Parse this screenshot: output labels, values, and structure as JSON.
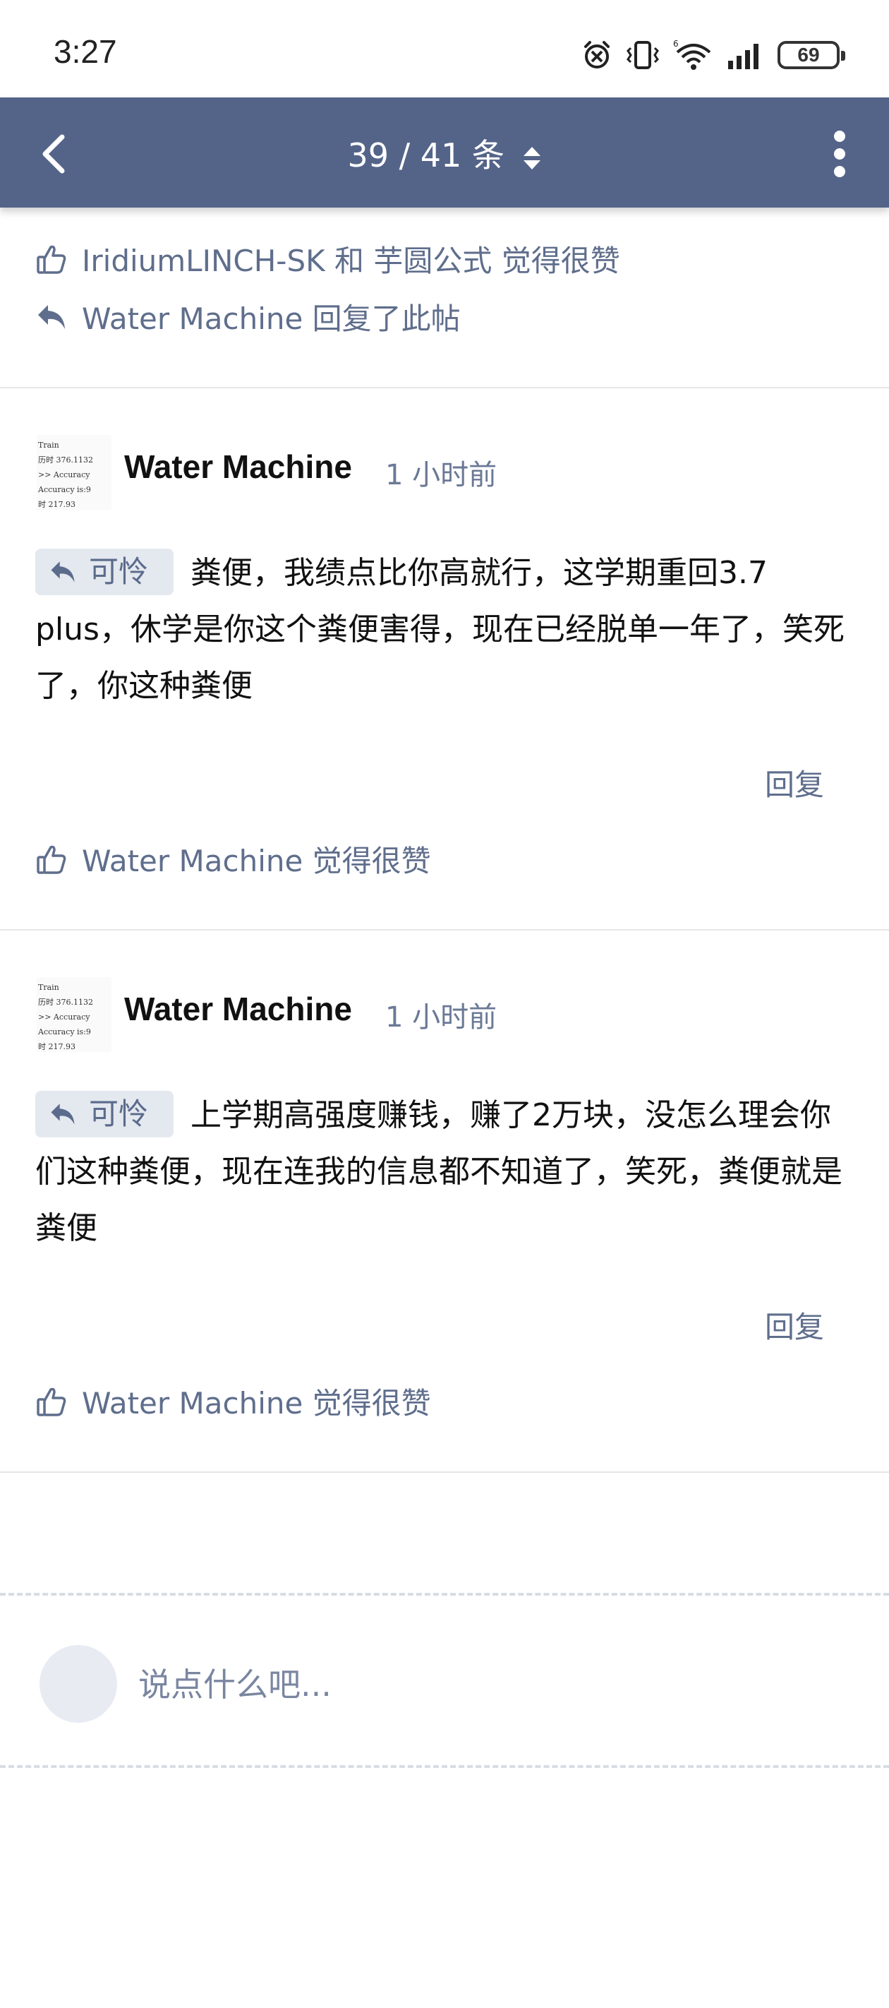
{
  "status_bar": {
    "time": "3:27",
    "battery": "69"
  },
  "header": {
    "counter": "39 / 41 条"
  },
  "activity_top": {
    "likes": "IridiumLINCH-SK 和 芋圆公式 觉得很赞",
    "replied": "Water Machine 回复了此帖"
  },
  "posts": [
    {
      "author": "Water Machine",
      "time_ago": "1 小时前",
      "quote_label": "可怜",
      "body": "粪便，我绩点比你高就行，这学期重回3.7 plus，休学是你这个粪便害得，现在已经脱单一年了，笑死了，你这种粪便",
      "reply_label": "回复",
      "likes": "Water Machine 觉得很赞"
    },
    {
      "author": "Water Machine",
      "time_ago": "1 小时前",
      "quote_label": "可怜",
      "body": "上学期高强度赚钱，赚了2万块，没怎么理会你们这种粪便，现在连我的信息都不知道了，笑死，粪便就是粪便",
      "reply_label": "回复",
      "likes": "Water Machine 觉得很赞"
    }
  ],
  "avatar_text": "Train\n历时 376.1132\n>> Accuracy\nAccuracy is:9\n时 217.93",
  "composer": {
    "placeholder": "说点什么吧..."
  },
  "colors": {
    "header_bg": "#546489",
    "meta_text": "#5f6e8c",
    "chip_bg": "#e4e8ef"
  },
  "icons": [
    "alarm-icon",
    "vibrate-icon",
    "wifi-icon",
    "signal-icon",
    "battery-icon",
    "back-arrow-icon",
    "sort-arrows-icon",
    "more-vert-icon",
    "thumbs-up-icon",
    "reply-arrow-icon"
  ]
}
